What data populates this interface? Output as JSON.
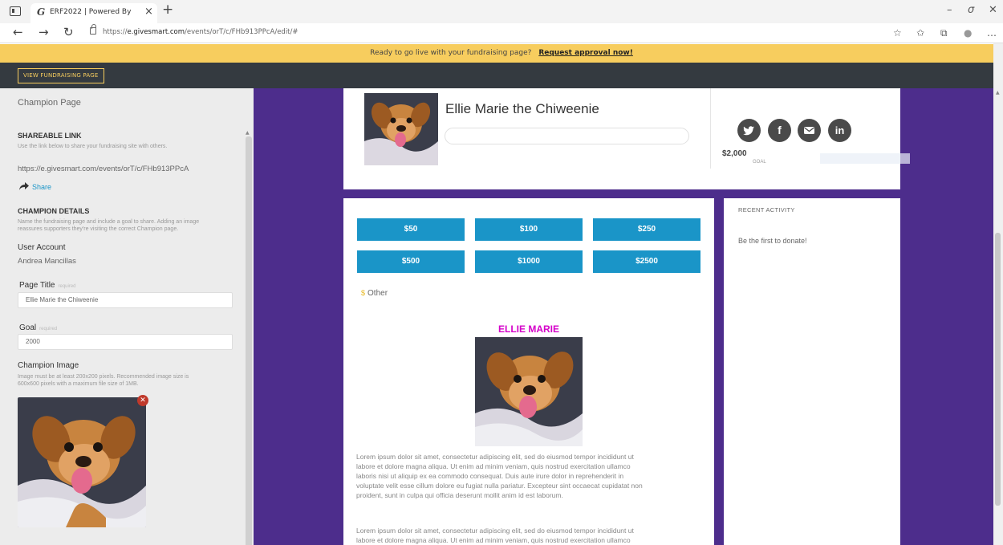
{
  "browser": {
    "tab_title": "ERF2022 | Powered By",
    "tab_favicon": "G",
    "url_prefix": "https://",
    "url_domain": "e.givesmart.com",
    "url_path": "/events/orT/c/FHb913PPcA/edit/#"
  },
  "banner": {
    "text": "Ready to go live with your fundraising page?",
    "link": "Request approval now!"
  },
  "topbar": {
    "view_button": "VIEW FUNDRAISING PAGE"
  },
  "sidebar": {
    "section_title": "Champion Page",
    "shareable_heading": "SHAREABLE LINK",
    "shareable_desc": "Use the link below to share your fundraising site with others.",
    "shareable_url": "https://e.givesmart.com/events/orT/c/FHb913PPcA",
    "share_label": "Share",
    "details_heading": "CHAMPION DETAILS",
    "details_desc_1": "Name the fundraising page and include a goal to share. Adding an image",
    "details_desc_2": "reassures supporters they're visiting the correct Champion page.",
    "user_account_label": "User Account",
    "user_account_value": "Andrea Mancillas",
    "page_title_label": "Page Title",
    "page_title_req": "required",
    "page_title_value": "Ellie Marie the Chiweenie",
    "goal_label": "Goal",
    "goal_req": "required",
    "goal_value": "2000",
    "image_label": "Champion Image",
    "image_desc_1": "Image must be at least 200x200 pixels. Recommended image size is",
    "image_desc_2": "600x600 pixels with a maximum file size of 1MB."
  },
  "champion": {
    "name": "Ellie Marie the Chiweenie",
    "goal_amount": "$2,000",
    "goal_label": "GOAL",
    "progress": 0
  },
  "social": [
    "twitter-icon",
    "facebook-icon",
    "email-icon",
    "linkedin-icon"
  ],
  "donate": {
    "amounts": [
      "$50",
      "$100",
      "$250",
      "$500",
      "$1000",
      "$2500"
    ],
    "other_label": "Other",
    "story_title": "ELLIE MARIE",
    "paragraph_1_lines": [
      "Lorem ipsum dolor sit amet, consectetur adipiscing elit, sed do eiusmod tempor incididunt ut",
      "labore et dolore magna aliqua. Ut enim ad minim veniam, quis nostrud exercitation ullamco",
      "laboris nisi ut aliquip ex ea commodo consequat. Duis aute irure dolor in reprehenderit in",
      "voluptate velit esse cillum dolore eu fugiat nulla pariatur. Excepteur sint occaecat cupidatat non",
      "proident, sunt in culpa qui officia deserunt mollit anim id est laborum."
    ],
    "paragraph_2_lines": [
      "Lorem ipsum dolor sit amet, consectetur adipiscing elit, sed do eiusmod tempor incididunt ut",
      "labore et dolore magna aliqua. Ut enim ad minim veniam, quis nostrud exercitation ullamco"
    ]
  },
  "activity": {
    "title": "RECENT ACTIVITY",
    "empty": "Be the first to donate!"
  },
  "colors": {
    "banner": "#f7cd5e",
    "purple": "#4d2d8c",
    "button_blue": "#1a95c8",
    "story_magenta": "#d500c9"
  }
}
